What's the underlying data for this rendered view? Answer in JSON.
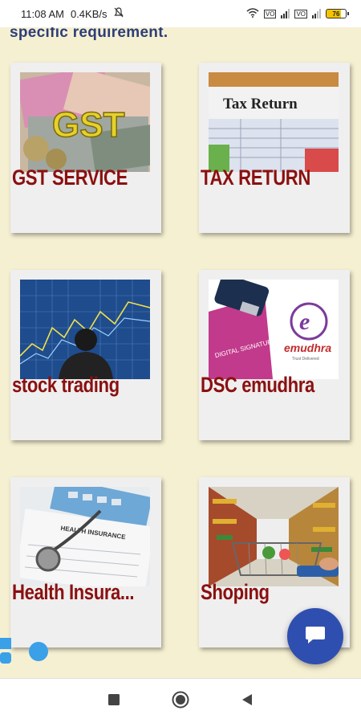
{
  "status_bar": {
    "time": "11:08 AM",
    "speed": "0.4KB/s",
    "sim1_label": "VoLTE",
    "sim2_label": "VoLTE",
    "battery": "76"
  },
  "intro": {
    "text": "specific requirement."
  },
  "services": [
    {
      "label": "GST SERVICE",
      "image": "gst-currency-image"
    },
    {
      "label": "TAX RETURN",
      "image": "tax-return-form-image"
    },
    {
      "label": "stock trading",
      "image": "stock-chart-man-image"
    },
    {
      "label": "DSC emudhra",
      "image": "usb-token-emudhra-image"
    },
    {
      "label": "Health Insura...",
      "image": "health-insurance-stethoscope-image"
    },
    {
      "label": "Shoping",
      "image": "shopping-cart-aisle-image"
    }
  ],
  "emudhra_logo_text": "emudhra",
  "emudhra_tagline": "Trust Delivered",
  "tax_form_title": "Tax Return",
  "usb_sticker_text": "DIGITAL SIGNATURE",
  "health_form_title": "HEALTH INSURANCE",
  "colors": {
    "background": "#f6f0d2",
    "label_red": "#8b1010",
    "intro_blue": "#2c3e7a",
    "fab_blue": "#2f4fb0",
    "card_bg": "#efefef"
  },
  "icons": {
    "chat": "chat-bubble-icon",
    "nav_recents": "square-icon",
    "nav_home": "circle-icon",
    "nav_back": "triangle-back-icon"
  }
}
